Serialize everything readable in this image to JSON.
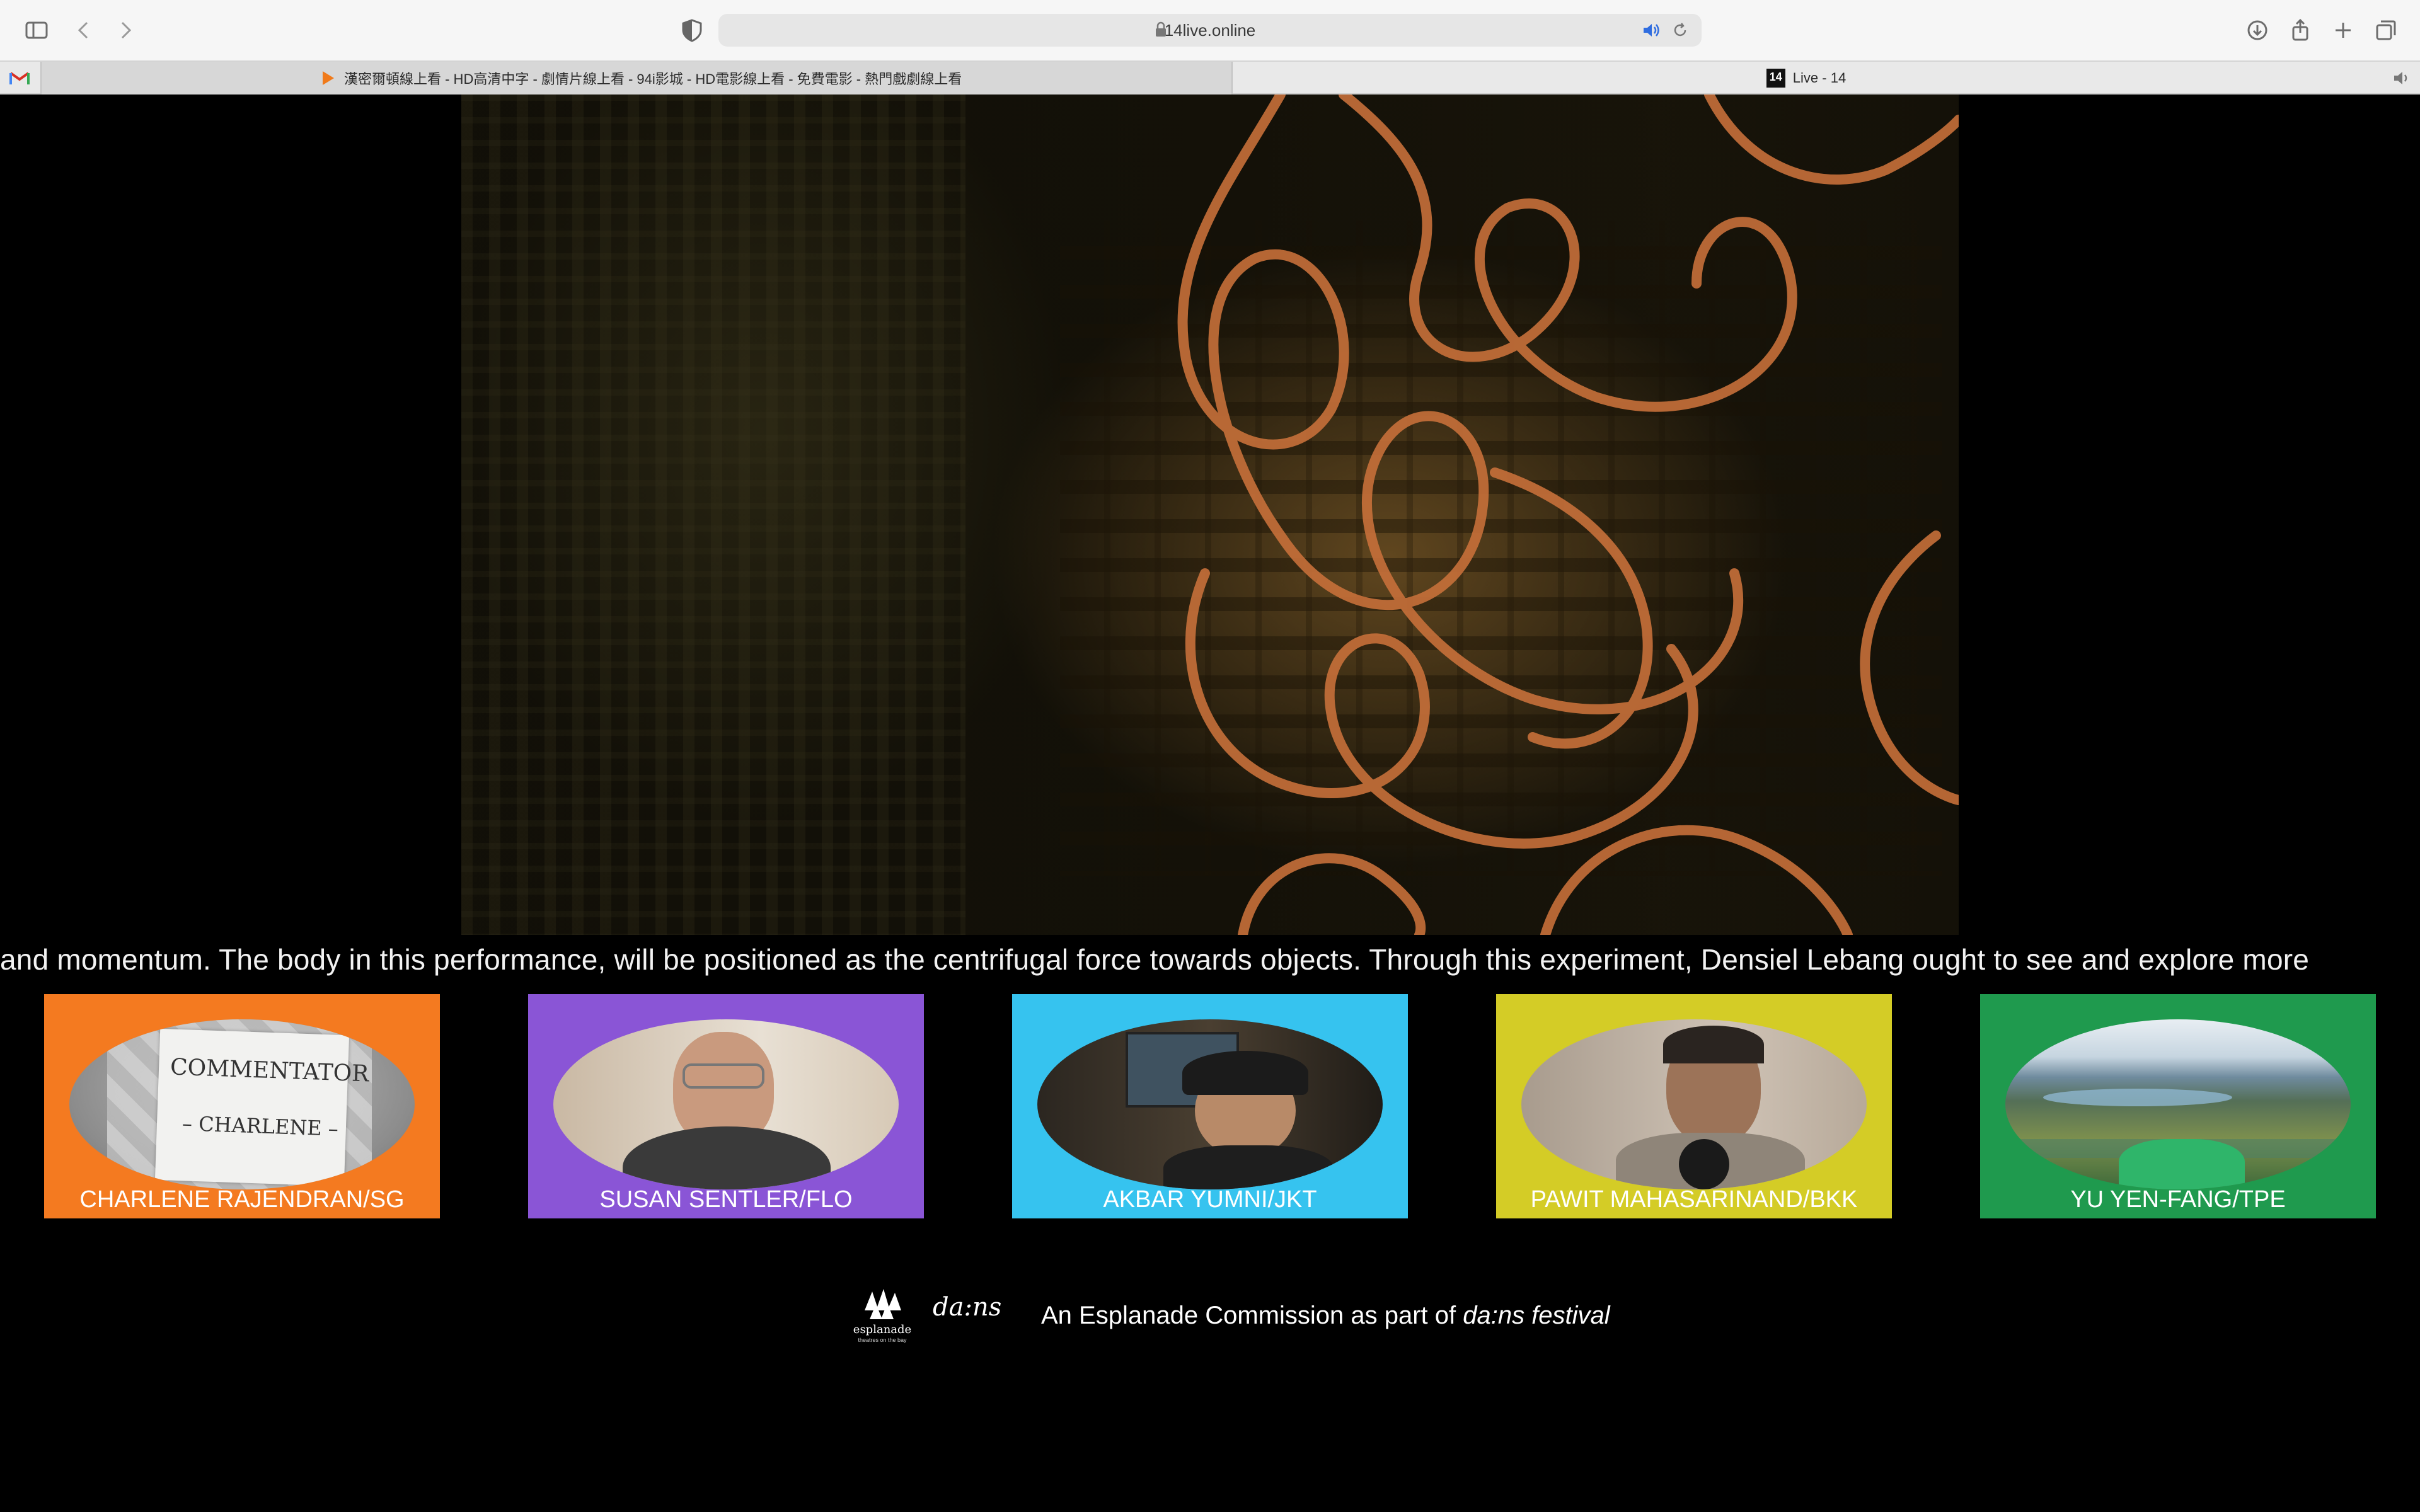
{
  "browser": {
    "url": "14live.online",
    "tabs": [
      {
        "title": "漢密爾頓線上看 - HD高清中字 - 劇情片線上看 - 94i影城 - HD電影線上看 - 免費電影 - 熱門戲劇線上看",
        "active": true
      },
      {
        "title": "Live - 14",
        "active": false
      }
    ]
  },
  "ticker": {
    "text": "and momentum. The body in this performance, will be positioned as the centrifugal force towards objects. Through this experiment, Densiel Lebang ought to see and explore more"
  },
  "participants": [
    {
      "name": "CHARLENE RAJENDRAN/SG",
      "color": "#f47a20",
      "sign_line1": "COMMENTATOR",
      "sign_line2": "– CHARLENE –"
    },
    {
      "name": "SUSAN SENTLER/FLO",
      "color": "#8a55d6"
    },
    {
      "name": "AKBAR YUMNI/JKT",
      "color": "#36c3ef"
    },
    {
      "name": "PAWIT MAHASARINAND/BKK",
      "color": "#d4cc26"
    },
    {
      "name": "YU YEN-FANG/TPE",
      "color": "#1f9a4e"
    }
  ],
  "footer": {
    "logo1_name": "esplanade",
    "logo1_sub": "theatres on the bay",
    "logo2_text": "da:ns",
    "credit_prefix": "An Esplanade Commission as part of ",
    "credit_emph": "da:ns festival"
  }
}
